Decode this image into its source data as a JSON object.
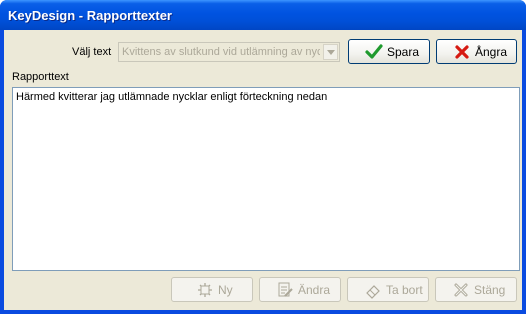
{
  "window": {
    "title": "KeyDesign - Rapporttexter"
  },
  "form": {
    "select_label": "Välj text",
    "select_value": "Kvittens av slutkund vid utlämning av nyckl",
    "text_label": "Rapporttext",
    "text_value": "Härmed kvitterar jag utlämnade nycklar enligt förteckning nedan"
  },
  "buttons": {
    "save": "Spara",
    "undo": "Ångra",
    "new": "Ny",
    "edit": "Ändra",
    "delete": "Ta bort",
    "close": "Stäng"
  },
  "icons": {
    "save": "check-icon",
    "undo": "red-x-icon",
    "new": "new-doc-icon",
    "edit": "edit-doc-icon",
    "delete": "eraser-icon",
    "close": "close-x-icon"
  },
  "colors": {
    "title_bar": "#0053e0",
    "client": "#ece9d8",
    "save_check": "#1f9a2e",
    "undo_x": "#d61a12",
    "disabled_text": "#aca899"
  }
}
